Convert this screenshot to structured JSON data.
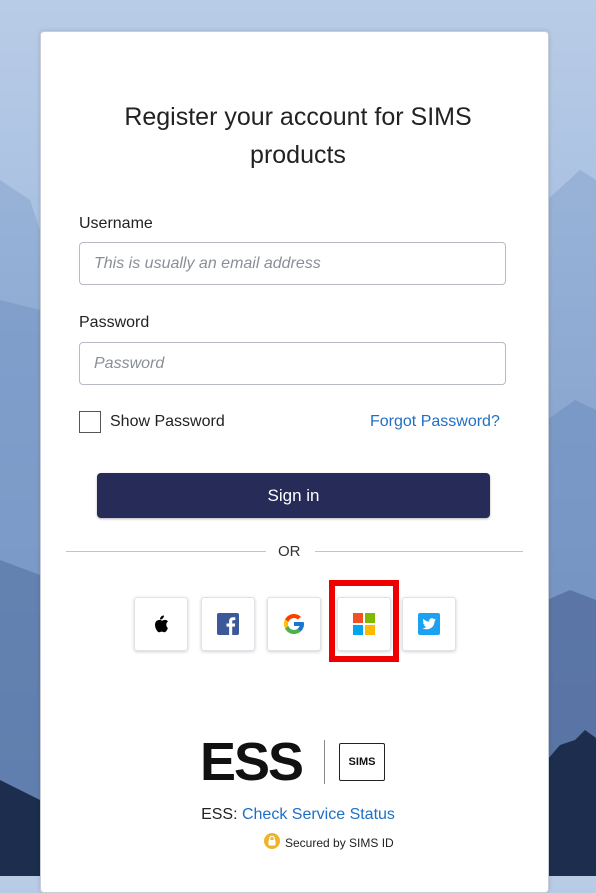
{
  "form": {
    "title_line1": "Register your account for SIMS",
    "title_line2": "products",
    "username_label": "Username",
    "username_placeholder": "This is usually an email address",
    "password_label": "Password",
    "password_placeholder": "Password",
    "show_password_label": "Show Password",
    "forgot_password": "Forgot Password?",
    "sign_in": "Sign in",
    "or": "OR"
  },
  "social": {
    "providers": [
      "apple-icon",
      "facebook-icon",
      "google-icon",
      "microsoft-icon",
      "twitter-icon"
    ],
    "highlighted": "microsoft"
  },
  "footer": {
    "ess_logo": "ESS",
    "sims_logo": "SIMS",
    "status_prefix": "ESS: ",
    "status_link": "Check Service Status",
    "secured": "Secured by SIMS ID"
  },
  "colors": {
    "accent": "#272b57",
    "link": "#1f6fc5",
    "highlight": "#ee0000"
  }
}
